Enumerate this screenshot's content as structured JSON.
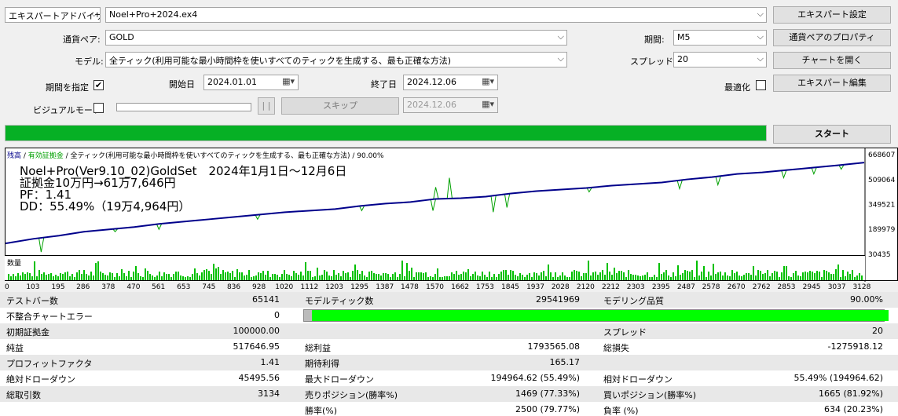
{
  "top": {
    "expert_type": "エキスパートアドバイザ",
    "expert_file": "Noel+Pro+2024.ex4",
    "symbol_label": "通貨ペア:",
    "symbol": "GOLD",
    "model_label": "モデル:",
    "model": "全ティック(利用可能な最小時間枠を使いすべてのティックを生成する、最も正確な方法)",
    "date_check_label": "期間を指定",
    "date_check_mark": "✔",
    "from_label": "開始日",
    "from": "2024.01.01",
    "to_label": "終了日",
    "to": "2024.12.06",
    "visual_label": "ビジュアルモード",
    "pause": "| |",
    "skip": "スキップ",
    "skip_date": "2024.12.06",
    "period_label": "期間:",
    "period": "M5",
    "spread_label": "スプレッド:",
    "spread": "20",
    "optimize_label": "最適化",
    "btn_expert_settings": "エキスパート設定",
    "btn_symbol_props": "通貨ペアのプロパティ",
    "btn_open_chart": "チャートを開く",
    "btn_edit_expert": "エキスパート編集",
    "btn_start": "スタート",
    "progress": 1.0,
    "arrow": "⌵",
    "cal": "▦▾"
  },
  "chart_data": {
    "type": "line",
    "header_balance": "残高",
    "header_sep": " / ",
    "header_equity": "有効証拠金",
    "header_rest": " / 全ティック(利用可能な最小時間枠を使いすべてのティックを生成する、最も正確な方法) / 90.00%",
    "overlay": [
      "Noel+Pro(Ver9.10_02)GoldSet　2024年1月1日～12月6日",
      "証拠金10万円→61万7,646円",
      "PF：1.41",
      "DD：55.49%（19万4,964円）"
    ],
    "y_ticks": [
      "668607",
      "509064",
      "349521",
      "189979",
      "30435"
    ],
    "y_values": [
      668607,
      509064,
      349521,
      189979,
      30435
    ],
    "ylim": [
      30435,
      668607
    ],
    "x_ticks": [
      "0",
      "103",
      "195",
      "286",
      "378",
      "470",
      "561",
      "653",
      "745",
      "836",
      "928",
      "1020",
      "1112",
      "1203",
      "1295",
      "1387",
      "1478",
      "1570",
      "1662",
      "1753",
      "1845",
      "1937",
      "2028",
      "2120",
      "2212",
      "2303",
      "2395",
      "2487",
      "2578",
      "2670",
      "2762",
      "2853",
      "2945",
      "3037",
      "3128"
    ],
    "x_max": 3134,
    "balance": [
      [
        0,
        100000
      ],
      [
        103,
        130000
      ],
      [
        195,
        150000
      ],
      [
        286,
        175000
      ],
      [
        378,
        190000
      ],
      [
        470,
        205000
      ],
      [
        561,
        225000
      ],
      [
        653,
        240000
      ],
      [
        745,
        255000
      ],
      [
        836,
        270000
      ],
      [
        928,
        285000
      ],
      [
        1020,
        300000
      ],
      [
        1112,
        310000
      ],
      [
        1203,
        320000
      ],
      [
        1295,
        340000
      ],
      [
        1387,
        355000
      ],
      [
        1478,
        365000
      ],
      [
        1570,
        385000
      ],
      [
        1662,
        390000
      ],
      [
        1753,
        400000
      ],
      [
        1845,
        420000
      ],
      [
        1937,
        435000
      ],
      [
        2028,
        445000
      ],
      [
        2120,
        455000
      ],
      [
        2212,
        470000
      ],
      [
        2303,
        480000
      ],
      [
        2395,
        490000
      ],
      [
        2487,
        510000
      ],
      [
        2578,
        525000
      ],
      [
        2670,
        545000
      ],
      [
        2762,
        555000
      ],
      [
        2853,
        570000
      ],
      [
        2945,
        585000
      ],
      [
        3037,
        600000
      ],
      [
        3134,
        617646
      ]
    ],
    "equity_dips": [
      [
        130,
        45000
      ],
      [
        400,
        175000
      ],
      [
        560,
        190000
      ],
      [
        920,
        255000
      ],
      [
        1300,
        310000
      ],
      [
        1560,
        310000
      ],
      [
        1570,
        460000
      ],
      [
        1620,
        520000
      ],
      [
        1780,
        300000
      ],
      [
        1830,
        330000
      ],
      [
        2130,
        430000
      ],
      [
        2460,
        450000
      ],
      [
        2600,
        475000
      ],
      [
        2840,
        520000
      ],
      [
        2950,
        545000
      ],
      [
        3050,
        575000
      ]
    ],
    "volume_label": "数量",
    "volume_color": "#00c000",
    "balance_color": "#00008b",
    "equity_color": "#00a000"
  },
  "stats": {
    "rows": [
      [
        "テストバー数",
        "65141",
        "モデルティック数",
        "29541969",
        "モデリング品質",
        "90.00%"
      ],
      [
        "不整合チャートエラー",
        "0",
        "",
        "",
        "",
        ""
      ],
      [
        "初期証拠金",
        "100000.00",
        "",
        "",
        "スプレッド",
        "20"
      ],
      [
        "純益",
        "517646.95",
        "総利益",
        "1793565.08",
        "総損失",
        "-1275918.12"
      ],
      [
        "プロフィットファクタ",
        "1.41",
        "期待利得",
        "165.17",
        "",
        ""
      ],
      [
        "絶対ドローダウン",
        "45495.56",
        "最大ドローダウン",
        "194964.62 (55.49%)",
        "相対ドローダウン",
        "55.49% (194964.62)"
      ],
      [
        "総取引数",
        "3134",
        "売りポジション(勝率%)",
        "1469 (77.33%)",
        "買いポジション(勝率%)",
        "1665 (81.92%)"
      ],
      [
        "",
        "",
        "勝率(%)",
        "2500 (79.77%)",
        "負率 (%)",
        "634 (20.23%)"
      ]
    ],
    "quality": 0.9
  }
}
